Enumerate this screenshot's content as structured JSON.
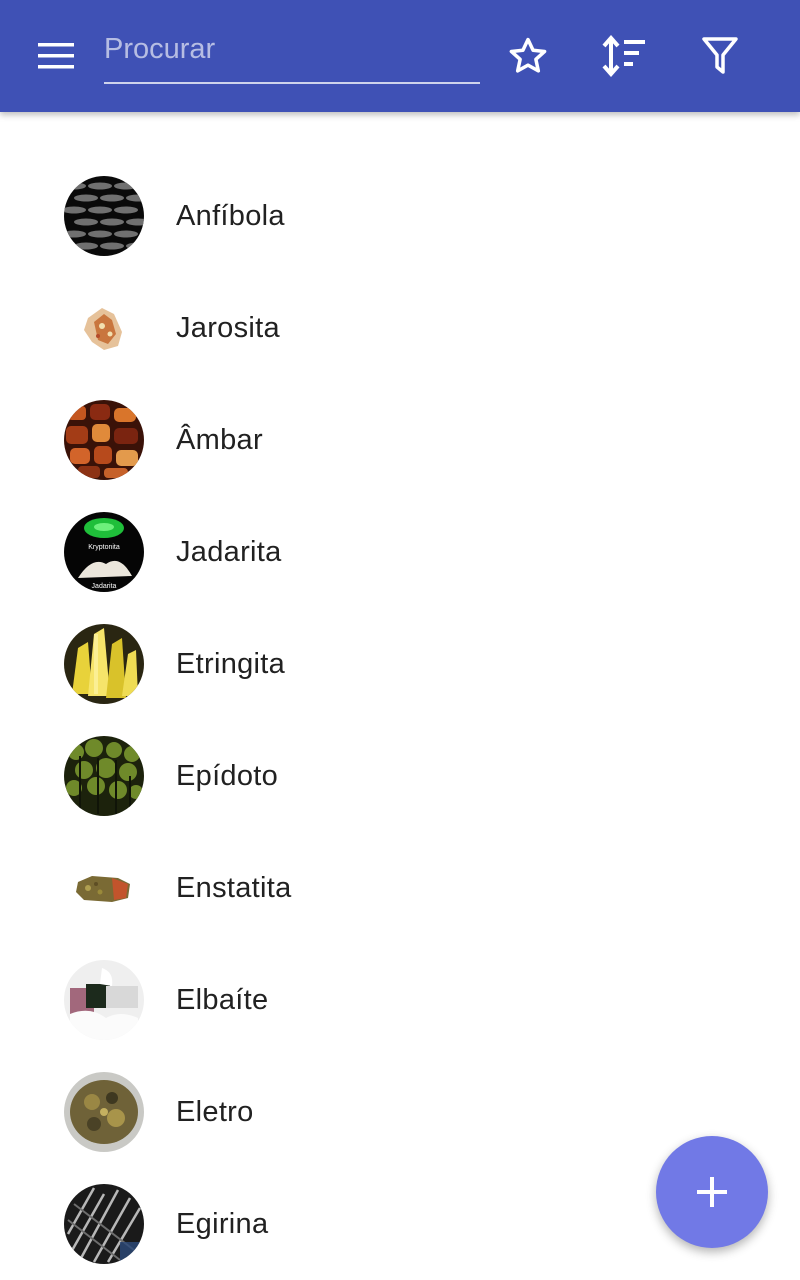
{
  "toolbar": {
    "background_color": "#3f51b5",
    "menu_icon": "menu-icon",
    "search": {
      "placeholder": "Procurar",
      "value": ""
    },
    "actions": [
      {
        "icon": "star-outline-icon"
      },
      {
        "icon": "sort-icon"
      },
      {
        "icon": "filter-icon"
      }
    ]
  },
  "minerals": [
    {
      "name": "Anfíbola"
    },
    {
      "name": "Jarosita"
    },
    {
      "name": "Âmbar"
    },
    {
      "name": "Jadarita",
      "thumb_text_top": "Kryptonita",
      "thumb_text_bottom": "Jadarita"
    },
    {
      "name": "Etringita"
    },
    {
      "name": "Epídoto"
    },
    {
      "name": "Enstatita"
    },
    {
      "name": "Elbaíte"
    },
    {
      "name": "Eletro"
    },
    {
      "name": "Egirina"
    }
  ],
  "fab": {
    "icon": "plus-icon",
    "color": "#7179e6"
  }
}
